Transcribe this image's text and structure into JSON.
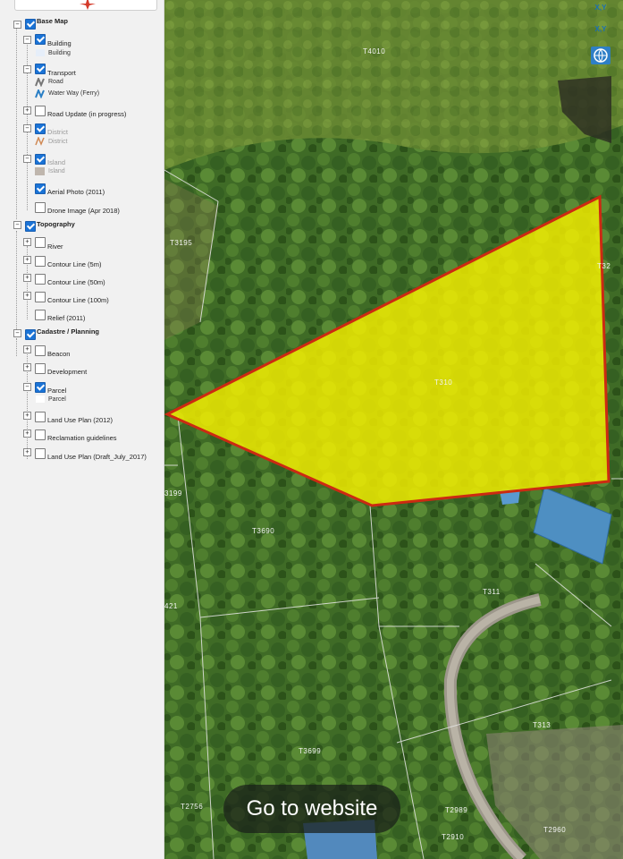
{
  "layers": {
    "base_map": {
      "label": "Base Map",
      "building": {
        "label": "Building",
        "legend": "Building"
      },
      "transport": {
        "label": "Transport",
        "legend_road": "Road",
        "legend_waterway": "Water Way (Ferry)"
      },
      "road_update": {
        "label": "Road Update (in progress)"
      },
      "district": {
        "label": "District",
        "legend": "District"
      },
      "island": {
        "label": "Island",
        "legend": "Island"
      },
      "aerial_photo": {
        "label": "Aerial Photo (2011)"
      },
      "drone_image": {
        "label": "Drone Image (Apr 2018)"
      }
    },
    "topography": {
      "label": "Topography",
      "river": {
        "label": "River"
      },
      "contour_5m": {
        "label": "Contour Line (5m)"
      },
      "contour_50m": {
        "label": "Contour Line (50m)"
      },
      "contour_100m": {
        "label": "Contour Line (100m)"
      },
      "relief": {
        "label": "Relief (2011)"
      }
    },
    "cadastre": {
      "label": "Cadastre / Planning",
      "beacon": {
        "label": "Beacon"
      },
      "development": {
        "label": "Development"
      },
      "parcel": {
        "label": "Parcel",
        "legend": "Parcel"
      },
      "land_use_2012": {
        "label": "Land Use Plan (2012)"
      },
      "reclamation": {
        "label": "Reclamation guidelines"
      },
      "land_use_draft": {
        "label": "Land Use Plan (Draft_July_2017)"
      }
    }
  },
  "map": {
    "parcels": {
      "t4010": "T4010",
      "t3195": "T3195",
      "t310": "T310",
      "t3199": "3199",
      "t3690": "T3690",
      "t311": "T311",
      "t421": "421",
      "t313": "T313",
      "t3699": "T3699",
      "t2756": "T2756",
      "t2989": "T2989",
      "t2910": "T2910",
      "t2960": "T2960",
      "t32_edge": "T32"
    },
    "selected_parcel_fill": "#f7f000",
    "selected_parcel_outline": "#cc2a12",
    "tools": {
      "xy_label_1": "X,Y",
      "xy_label_2": "X,Y"
    }
  },
  "cta": {
    "label": "Go to website"
  }
}
